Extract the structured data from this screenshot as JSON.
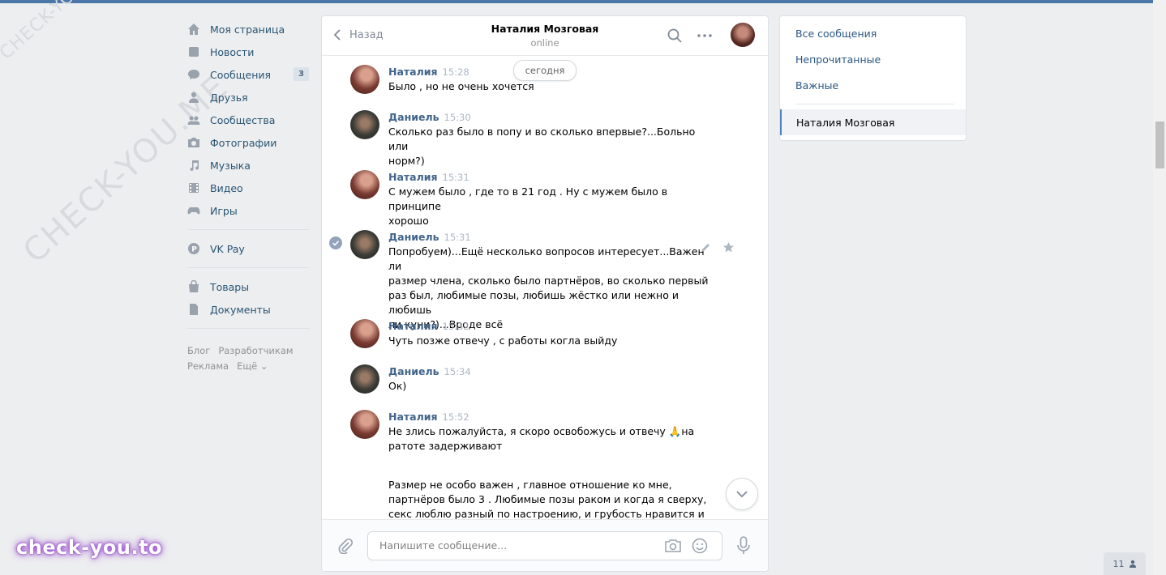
{
  "watermark": {
    "small": "CHECK-YOU.ME",
    "large": "CHECK-YOU.ME",
    "brand": "check-you.to"
  },
  "sidebar": {
    "items": [
      {
        "label": "Моя страница",
        "icon": "home-icon"
      },
      {
        "label": "Новости",
        "icon": "news-icon"
      },
      {
        "label": "Сообщения",
        "icon": "messages-icon",
        "badge": "3"
      },
      {
        "label": "Друзья",
        "icon": "friends-icon"
      },
      {
        "label": "Сообщества",
        "icon": "groups-icon"
      },
      {
        "label": "Фотографии",
        "icon": "camera-icon"
      },
      {
        "label": "Музыка",
        "icon": "music-icon"
      },
      {
        "label": "Видео",
        "icon": "video-icon"
      },
      {
        "label": "Игры",
        "icon": "games-icon"
      },
      {
        "label": "VK Pay",
        "icon": "vkpay-icon"
      },
      {
        "label": "Товары",
        "icon": "bag-icon"
      },
      {
        "label": "Документы",
        "icon": "document-icon"
      }
    ],
    "footer": {
      "blog": "Блог",
      "devs": "Разработчикам",
      "ads": "Реклама",
      "more": "Ещё ⌄"
    }
  },
  "chat": {
    "back_label": "Назад",
    "title": "Наталия Мозговая",
    "status": "online",
    "date_label": "сегодня",
    "messages": [
      {
        "author": "Наталия",
        "time": "15:28",
        "text": "Было , но не очень хочется"
      },
      {
        "author": "Даниель",
        "time": "15:30",
        "text": "Сколько раз было в попу и во сколько впервые?...Больно или\nнорм?)"
      },
      {
        "author": "Наталия",
        "time": "15:31",
        "text": "С мужем было , где то в 21 год . Ну с мужем было в принципе\nхорошо"
      },
      {
        "author": "Даниель",
        "time": "15:31",
        "text": "Попробуем)...Ещё несколько вопросов интересует...Важен ли\nразмер члена, сколько было партнёров, во сколько первый\nраз был, любимые позы, любишь жёстко или нежно и любишь\nли куни?)...Вроде всё"
      },
      {
        "author": "Наталия",
        "time": "15:32",
        "text": "Чуть позже отвечу , с работы когла выйду"
      },
      {
        "author": "Даниель",
        "time": "15:34",
        "text": "Ок)"
      },
      {
        "author": "Наталия",
        "time": "15:52",
        "text": "Не злись пожалуйста, я скоро освобожусь и отвечу 🙏на\nратоте задерживают"
      },
      {
        "author": "",
        "time": "",
        "text": "Размер не особо важен , главное отношение ко мне,\nпартнёров было 3 . Любимые позы раком и когда я сверху,\nсекс люблю разный по настроению, и грубость нравится и\nнежность , куни обожаю"
      }
    ],
    "input_placeholder": "Напишите сообщение..."
  },
  "right_panel": {
    "all": "Все сообщения",
    "unread": "Непрочитанные",
    "important": "Важные",
    "active_chat": "Наталия Мозговая"
  },
  "online_counter": "11",
  "colors": {
    "accent": "#4a76a8",
    "link": "#2a5885",
    "name": "#42648b",
    "background": "#edeef0"
  }
}
